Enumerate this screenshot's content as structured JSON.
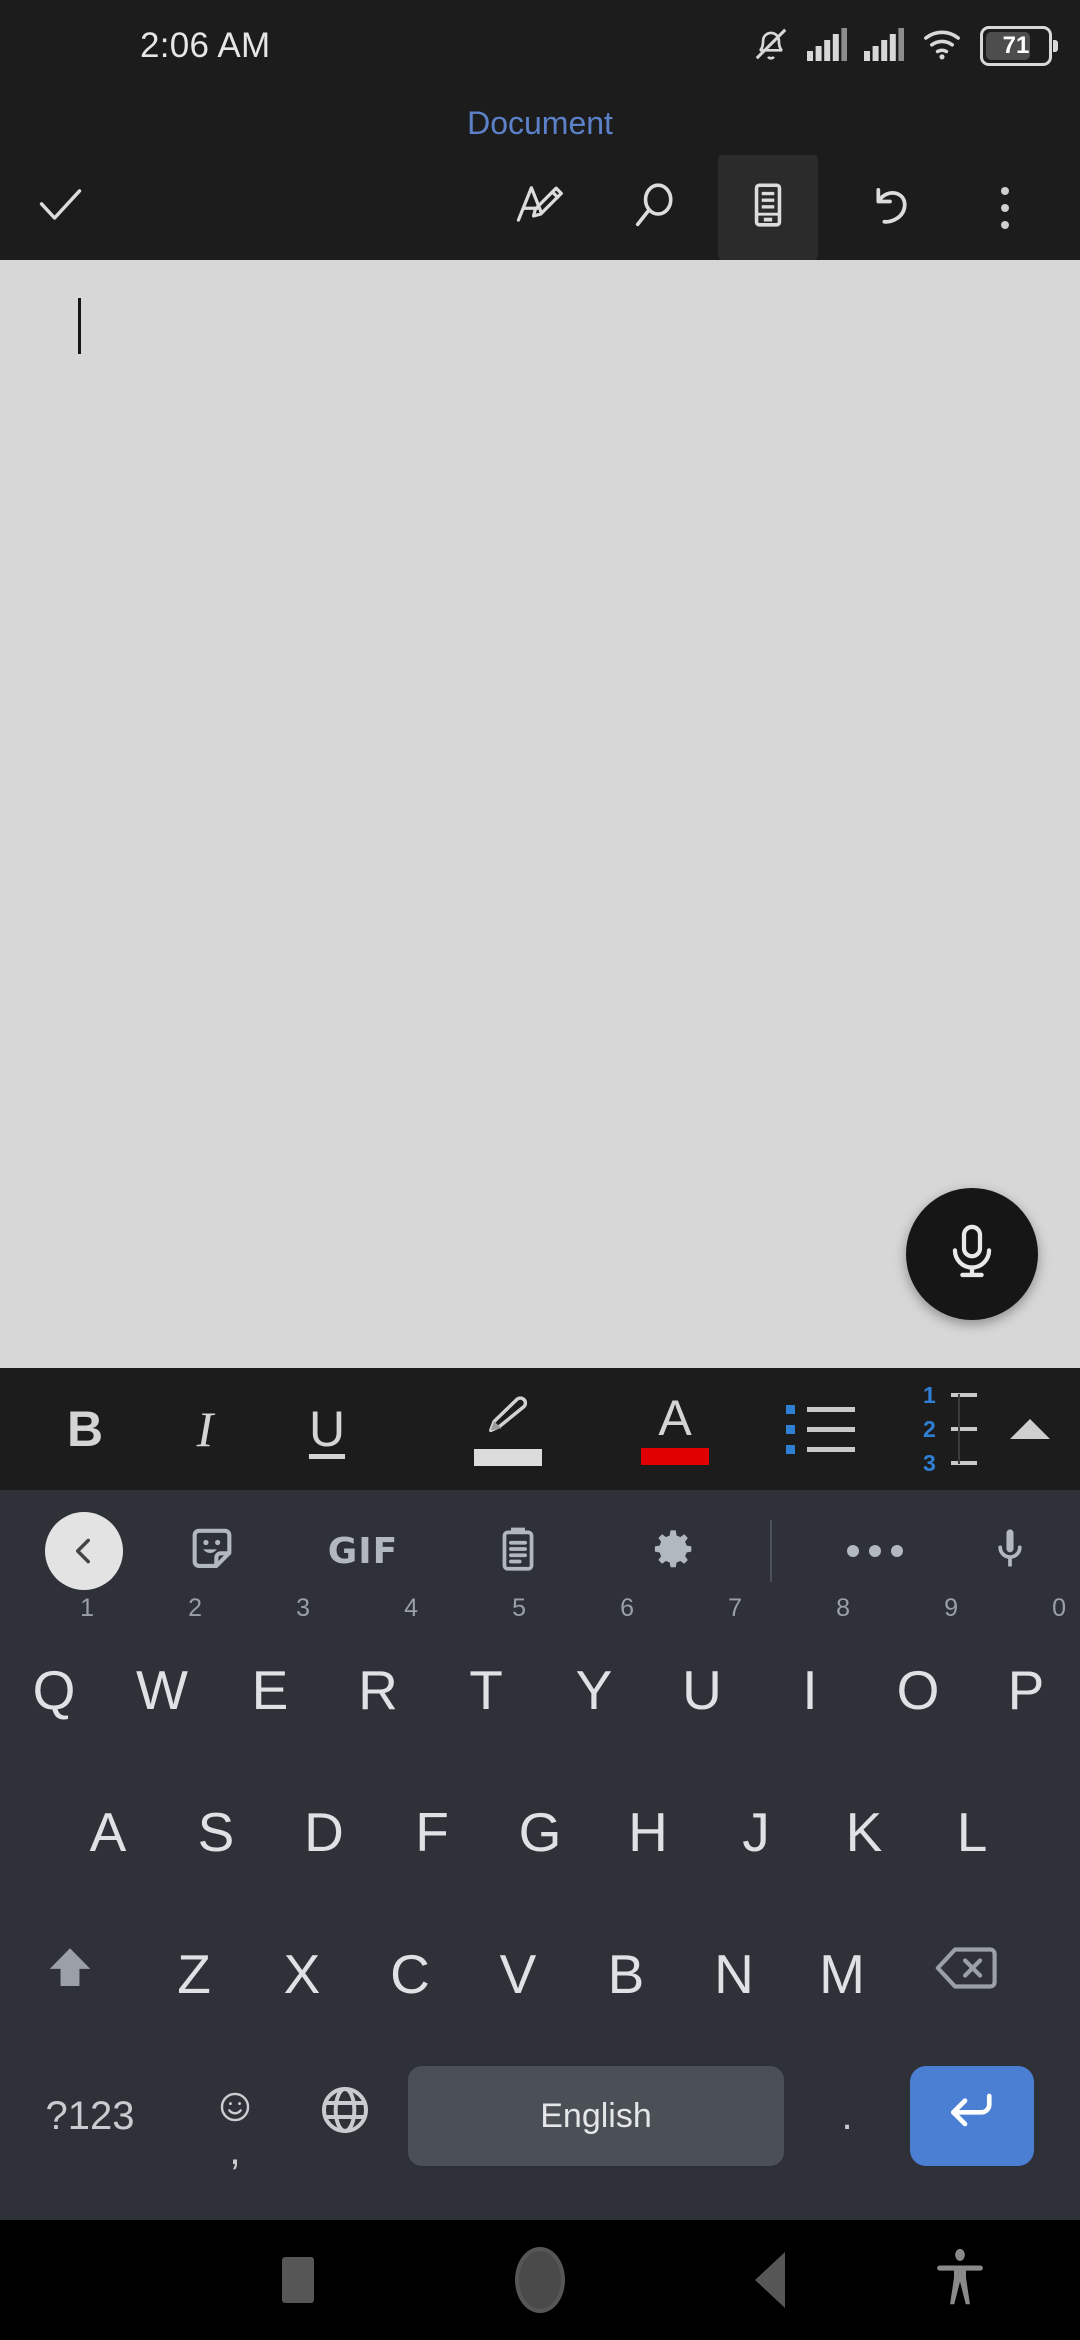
{
  "status_bar": {
    "time": "2:06 AM",
    "battery_percent": "71",
    "icons": [
      "bell-muted-icon",
      "signal-bars-icon",
      "signal-bars-icon",
      "wifi-icon",
      "battery-icon"
    ]
  },
  "app": {
    "title": "Document",
    "title_color": "#5c81c9",
    "toolbar": [
      {
        "name": "done-check-button",
        "icon": "check-icon",
        "selected": false
      },
      {
        "name": "draw-button",
        "icon": "pen-edit-icon",
        "selected": false
      },
      {
        "name": "search-button",
        "icon": "search-icon",
        "selected": false
      },
      {
        "name": "mobile-view-button",
        "icon": "mobile-view-icon",
        "selected": true
      },
      {
        "name": "undo-button",
        "icon": "undo-icon",
        "selected": false
      },
      {
        "name": "overflow-menu-button",
        "icon": "kebab-menu-icon",
        "selected": false
      }
    ]
  },
  "document": {
    "body_text": "",
    "background_color": "#d7d7d7",
    "caret_visible": true,
    "dictation_button_label": "microphone-icon"
  },
  "format_bar": {
    "items": [
      {
        "name": "bold-button",
        "label": "B",
        "style": "bold"
      },
      {
        "name": "italic-button",
        "label": "I",
        "style": "italic"
      },
      {
        "name": "underline-button",
        "label": "U",
        "style": "underline"
      },
      {
        "name": "highlight-button",
        "icon": "highlighter-icon",
        "swatch_color": "#dcdcdc"
      },
      {
        "name": "font-color-button",
        "label": "A",
        "swatch_color": "#e00000"
      },
      {
        "name": "bulleted-list-button",
        "icon": "bulleted-list-icon",
        "accent": "#2f7fd4"
      },
      {
        "name": "numbered-list-button",
        "icon": "numbered-list-icon",
        "numbers": [
          "1",
          "2",
          "3"
        ],
        "accent": "#2f7fd4"
      },
      {
        "name": "collapse-format-bar-button",
        "icon": "chevron-up-icon"
      }
    ]
  },
  "keyboard": {
    "toolbar": [
      {
        "name": "keyboard-back-button",
        "icon": "chevron-left-icon"
      },
      {
        "name": "sticker-button",
        "icon": "sticker-icon"
      },
      {
        "name": "gif-button",
        "icon": "gif-icon",
        "label": "GIF"
      },
      {
        "name": "clipboard-button",
        "icon": "clipboard-icon"
      },
      {
        "name": "keyboard-settings-button",
        "icon": "gear-icon"
      },
      {
        "name": "keyboard-more-button",
        "icon": "more-dots-icon"
      },
      {
        "name": "voice-input-button",
        "icon": "microphone-icon"
      }
    ],
    "row1": [
      {
        "key": "Q",
        "sup": "1"
      },
      {
        "key": "W",
        "sup": "2"
      },
      {
        "key": "E",
        "sup": "3"
      },
      {
        "key": "R",
        "sup": "4"
      },
      {
        "key": "T",
        "sup": "5"
      },
      {
        "key": "Y",
        "sup": "6"
      },
      {
        "key": "U",
        "sup": "7"
      },
      {
        "key": "I",
        "sup": "8"
      },
      {
        "key": "O",
        "sup": "9"
      },
      {
        "key": "P",
        "sup": "0"
      }
    ],
    "row2": [
      "A",
      "S",
      "D",
      "F",
      "G",
      "H",
      "J",
      "K",
      "L"
    ],
    "row3": [
      "Z",
      "X",
      "C",
      "V",
      "B",
      "N",
      "M"
    ],
    "shift_label": "shift-icon",
    "backspace_label": "backspace-icon",
    "symbols_key": "?123",
    "emoji_key": "emoji-icon",
    "comma_key": ",",
    "language_key": "globe-icon",
    "spacebar_label": "English",
    "period_key": ".",
    "enter_key": "enter-icon",
    "enter_color": "#4a7fd4",
    "background_color": "#2e3238"
  },
  "nav_bar": [
    {
      "name": "recents-button",
      "icon": "square-icon"
    },
    {
      "name": "home-button",
      "icon": "circle-icon"
    },
    {
      "name": "back-button",
      "icon": "triangle-left-icon"
    },
    {
      "name": "accessibility-button",
      "icon": "accessibility-icon"
    }
  ]
}
